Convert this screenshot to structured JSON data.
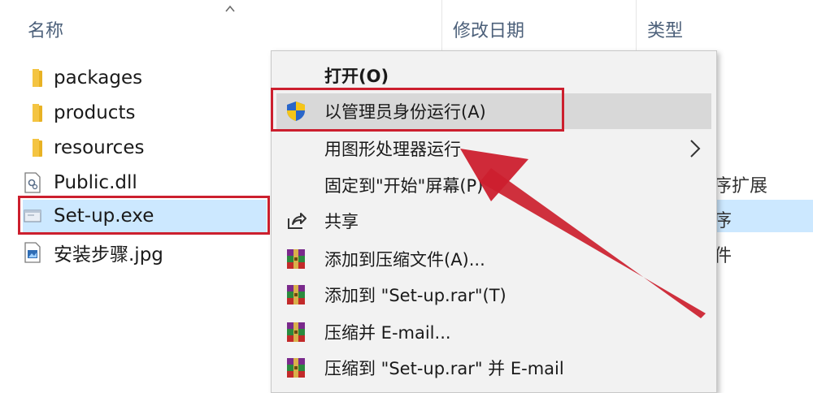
{
  "header": {
    "col_name": "名称",
    "col_date": "修改日期",
    "col_type": "类型"
  },
  "files": [
    {
      "name": "packages",
      "icon": "folder-icon"
    },
    {
      "name": "products",
      "icon": "folder-icon"
    },
    {
      "name": "resources",
      "icon": "folder-icon"
    },
    {
      "name": "Public.dll",
      "icon": "dll-file-icon"
    },
    {
      "name": "Set-up.exe",
      "icon": "exe-file-icon",
      "selected": true
    },
    {
      "name": "安装步骤.jpg",
      "icon": "image-file-icon"
    }
  ],
  "type_column_partial": {
    "row4": "序扩展",
    "row5": "序",
    "row6": "件"
  },
  "context_menu": {
    "items": [
      {
        "label": "打开(O)",
        "bold": true
      },
      {
        "label": "以管理员身份运行(A)",
        "icon": "uac-shield-icon",
        "highlighted": true
      },
      {
        "label": "用图形处理器运行",
        "submenu": true
      },
      {
        "label": "固定到\"开始\"屏幕(P)"
      },
      {
        "label": "共享",
        "icon": "share-icon"
      },
      {
        "label": "添加到压缩文件(A)...",
        "icon": "winrar-icon"
      },
      {
        "label": "添加到 \"Set-up.rar\"(T)",
        "icon": "winrar-icon"
      },
      {
        "label": "压缩并 E-mail...",
        "icon": "winrar-icon"
      },
      {
        "label": "压缩到 \"Set-up.rar\" 并 E-mail",
        "icon": "winrar-icon"
      }
    ]
  },
  "colors": {
    "annotation_red": "#cc1f2e",
    "selection_blue": "#cce8ff",
    "menu_bg": "#f2f2f2",
    "folder_yellow": "#f4c442"
  }
}
